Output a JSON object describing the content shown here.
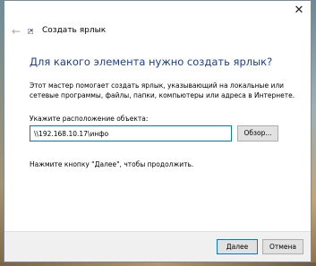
{
  "window": {
    "title": "Создать ярлык",
    "close_glyph": "✕",
    "back_glyph": "←"
  },
  "wizard": {
    "heading": "Для какого элемента нужно создать ярлык?",
    "description": "Этот мастер помогает создать ярлык, указывающий на локальные или сетевые программы, файлы, папки, компьютеры или адреса в Интернете.",
    "location_label": "Укажите расположение объекта:",
    "location_value": "\\\\192.168.10.17\\инфо",
    "browse_label": "Обзор...",
    "hint": "Нажмите кнопку \"Далее\", чтобы продолжить."
  },
  "footer": {
    "next_label": "Далее",
    "cancel_label": "Отмена"
  },
  "colors": {
    "heading": "#1a3e8c",
    "focus_border": "#0078d7",
    "button_bg": "#e1e1e1",
    "footer_bg": "#f0f0f0"
  },
  "icons": {
    "back": "back-arrow-icon",
    "close": "close-icon",
    "wizard": "shortcut-icon"
  }
}
